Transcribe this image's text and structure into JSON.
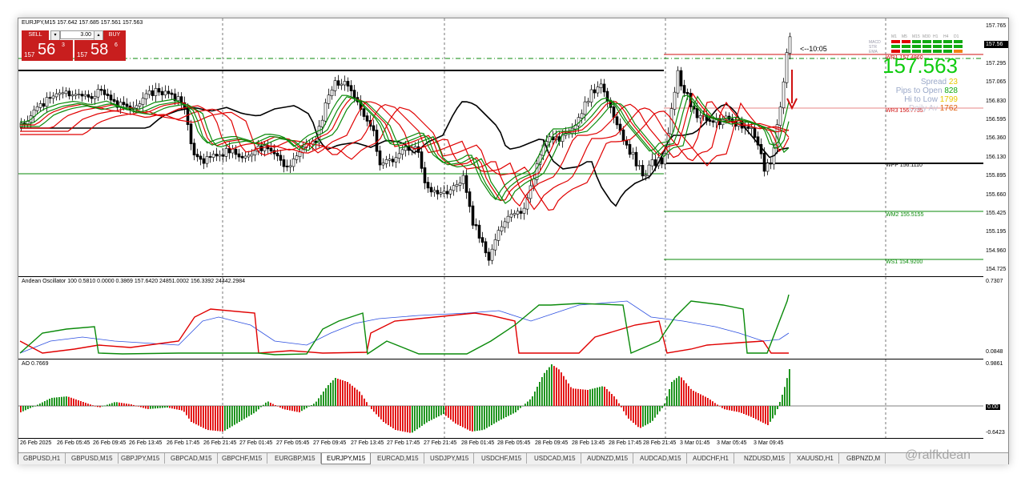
{
  "chart_title": "EURJPY,M15  157.642 157.685 157.561 157.563",
  "trade": {
    "sell_label": "SELL",
    "buy_label": "BUY",
    "lot": "3.00",
    "sell_small": "157",
    "sell_big": "56",
    "sell_sup": "3",
    "buy_small": "157",
    "buy_big": "58",
    "buy_sup": "6"
  },
  "price_axis": [
    "157.765",
    "157.530",
    "157.295",
    "157.065",
    "156.830",
    "156.595",
    "156.360",
    "156.130",
    "155.895",
    "155.660",
    "155.425",
    "155.195",
    "154.960",
    "154.725"
  ],
  "current_price_tag": "157.56",
  "levels": {
    "wr1": "WR1 157.4860",
    "wr3": "WR3 156.7735",
    "wpp": "WPP 156.1110",
    "wm2": "WM2 155.5155",
    "ws1": "WS1 154.9200"
  },
  "countdown": "<--10:05",
  "info_panel": {
    "price": "157.563",
    "spread_label": "Spread",
    "spread": "23",
    "pips_label": "Pips to Open",
    "pips": "828",
    "hilo_label": "Hi to Low",
    "hilo": "1799",
    "daily_label": "Daily Av",
    "daily": "1762",
    "tf_headers": [
      "M1",
      "M5",
      "M15",
      "M30",
      "H1",
      "H4",
      "D1"
    ],
    "row_labels": [
      "MACD",
      "STR",
      "EMA"
    ]
  },
  "oscillator": {
    "label": "Andean Oscillator 100 0.5810 0.0000 0.3869 157.6420 24851.0002 156.3392 24442.2984",
    "axis_top": "0.7307",
    "axis_bottom": "0.0848"
  },
  "ao": {
    "label": "AO 0.7669",
    "axis_top": "0.9861",
    "axis_mid": "0.00",
    "axis_bottom": "-0.6423"
  },
  "time_axis": [
    "26 Feb 2025",
    "26 Feb 05:45",
    "26 Feb 09:45",
    "26 Feb 13:45",
    "26 Feb 17:45",
    "26 Feb 21:45",
    "27 Feb 01:45",
    "27 Feb 05:45",
    "27 Feb 09:45",
    "27 Feb 13:45",
    "27 Feb 17:45",
    "27 Feb 21:45",
    "28 Feb 01:45",
    "28 Feb 05:45",
    "28 Feb 09:45",
    "28 Feb 13:45",
    "28 Feb 17:45",
    "28 Feb 21:45",
    "3 Mar 01:45",
    "3 Mar 05:45",
    "3 Mar 09:45"
  ],
  "tabs": [
    "GBPUSD,H1",
    "GBPUSD,M15",
    "GBPJPY,M15",
    "GBPCAD,M15",
    "GBPCHF,M15",
    "EURGBP,M15",
    "EURJPY,M15",
    "EURCAD,M15",
    "USDJPY,M15",
    "USDCHF,M15",
    "USDCAD,M15",
    "AUDNZD,M15",
    "AUDCAD,M15",
    "AUDCHF,H1",
    "NZDUSD,M15",
    "XAUUSD,H1",
    "GBPNZD,M"
  ],
  "active_tab": "EURJPY,M15",
  "watermark": "@ralfkdean",
  "colors": {
    "up": "#0a8a0a",
    "down": "#e00000",
    "trade": "#c81e1e",
    "blue": "#2b4ee0"
  }
}
